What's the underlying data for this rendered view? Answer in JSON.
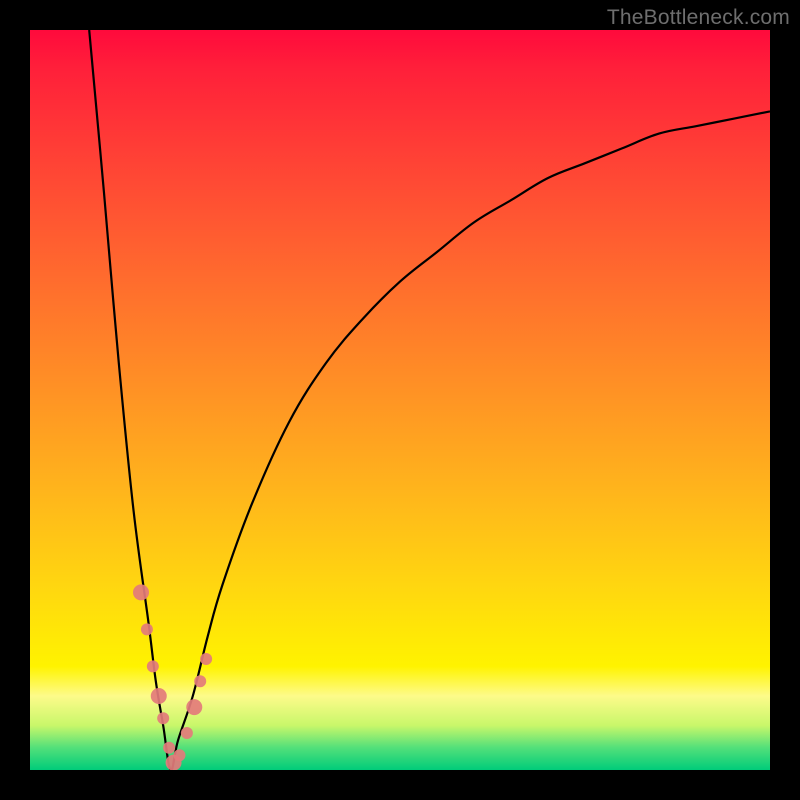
{
  "attribution": {
    "watermark": "TheBottleneck.com"
  },
  "colors": {
    "frame": "#000000",
    "gradient_top": "#ff0a3c",
    "gradient_mid1": "#ff6a2e",
    "gradient_mid2": "#ffd610",
    "gradient_bottom": "#00cc7a",
    "curve": "#000000",
    "markers": "#e37b7b"
  },
  "chart_data": {
    "type": "line",
    "title": "",
    "xlabel": "",
    "ylabel": "",
    "xlim": [
      0,
      100
    ],
    "ylim": [
      0,
      100
    ],
    "notes": "V-shaped bottleneck curve; minimum (0%) around x≈19; left branch rises steeply to 100% at x≈8; right branch rises asymptotically, reaching ~90% by x=100. Y-values are approximate % deviation read from the gradient.",
    "series": [
      {
        "name": "bottleneck-curve",
        "x": [
          8,
          10,
          12,
          14,
          16,
          17,
          18,
          19,
          20,
          22,
          24,
          26,
          30,
          35,
          40,
          45,
          50,
          55,
          60,
          65,
          70,
          75,
          80,
          85,
          90,
          95,
          100
        ],
        "values": [
          100,
          78,
          55,
          35,
          20,
          12,
          6,
          0,
          4,
          10,
          18,
          25,
          36,
          47,
          55,
          61,
          66,
          70,
          74,
          77,
          80,
          82,
          84,
          86,
          87,
          88,
          89
        ]
      }
    ],
    "markers": {
      "name": "highlighted-points",
      "comment": "Salmon dots clustered near the minimum of the V",
      "x": [
        15.0,
        15.8,
        16.6,
        17.4,
        18.0,
        18.8,
        19.4,
        20.2,
        21.2,
        22.2,
        23.0,
        23.8
      ],
      "values": [
        24,
        19,
        14,
        10,
        7,
        3,
        1,
        2,
        5,
        8.5,
        12,
        15
      ]
    }
  }
}
